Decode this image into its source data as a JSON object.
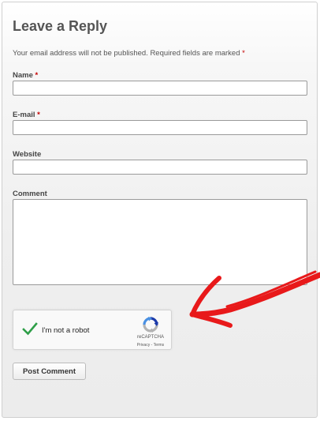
{
  "form": {
    "title": "Leave a Reply",
    "notice": "Your email address will not be published. Required fields are marked",
    "required_mark": "*",
    "fields": {
      "name": {
        "label": "Name",
        "required_mark": "*",
        "value": ""
      },
      "email": {
        "label": "E-mail",
        "required_mark": "*",
        "value": ""
      },
      "website": {
        "label": "Website",
        "value": ""
      },
      "comment": {
        "label": "Comment",
        "value": ""
      }
    },
    "captcha": {
      "label": "I'm not a robot",
      "checked": true,
      "check_color": "#2e9e48",
      "brand": "reCAPTCHA",
      "privacy": "Privacy",
      "separator": " - ",
      "terms": "Terms",
      "logo_icon": "recaptcha-logo-icon"
    },
    "submit_label": "Post Comment"
  },
  "annotation": {
    "arrow_color": "#e8191a",
    "arrow_icon": "hand-drawn-arrow-icon"
  },
  "colors": {
    "required": "#c40000",
    "title": "#555555"
  }
}
